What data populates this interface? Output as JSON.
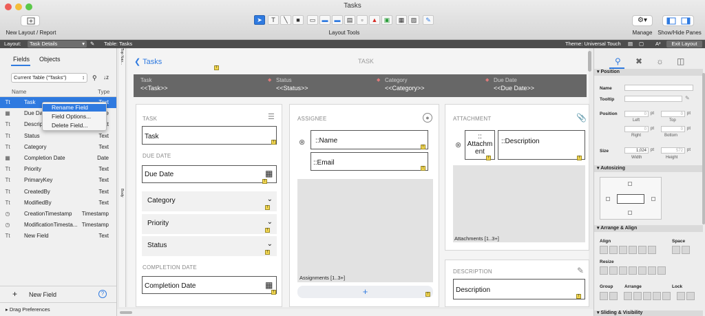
{
  "window": {
    "title": "Tasks"
  },
  "toolbar": {
    "new_layout_label": "New Layout / Report",
    "layout_tools_label": "Layout Tools",
    "manage_label": "Manage",
    "show_hide_label": "Show/Hide Panes",
    "tool_text_glyph": "T"
  },
  "layout_bar": {
    "layout_label": "Layout:",
    "layout_value": "Task Details",
    "table_label": "Table: Tasks",
    "theme_label": "Theme: Universal Touch",
    "exit_label": "Exit Layout",
    "aa_glyph": "A²"
  },
  "left_pane": {
    "tabs": [
      "Fields",
      "Objects"
    ],
    "table_select": "Current Table (\"Tasks\")",
    "sort_glyph": "↓z",
    "col_name": "Name",
    "col_type": "Type",
    "fields": [
      {
        "icon": "Tt",
        "name": "Task",
        "type": "Text",
        "selected": true
      },
      {
        "icon": "▦",
        "name": "Due Date",
        "type": "Date"
      },
      {
        "icon": "Tt",
        "name": "Description",
        "type": "Text"
      },
      {
        "icon": "Tt",
        "name": "Status",
        "type": "Text"
      },
      {
        "icon": "Tt",
        "name": "Category",
        "type": "Text"
      },
      {
        "icon": "▦",
        "name": "Completion Date",
        "type": "Date"
      },
      {
        "icon": "Tt",
        "name": "Priority",
        "type": "Text"
      },
      {
        "icon": "Tt",
        "name": "PrimaryKey",
        "type": "Text"
      },
      {
        "icon": "Tt",
        "name": "CreatedBy",
        "type": "Text"
      },
      {
        "icon": "Tt",
        "name": "ModifiedBy",
        "type": "Text"
      },
      {
        "icon": "◷",
        "name": "CreationTimestamp",
        "type": "Timestamp"
      },
      {
        "icon": "◷",
        "name": "ModificationTimesta...",
        "type": "Timestamp"
      },
      {
        "icon": "Tt",
        "name": "New Field",
        "type": "Text"
      }
    ],
    "new_field_label": "New Field",
    "help_glyph": "?",
    "drag_prefs_label": "Drag Preferences"
  },
  "context_menu": {
    "items": [
      "Rename Field",
      "Field Options...",
      "Delete Field..."
    ]
  },
  "canvas": {
    "top_nav_label": "Top Nav...",
    "body_label": "Body",
    "back_label": "Tasks",
    "header_title": "TASK",
    "header_columns": [
      {
        "label": "Task",
        "field": "<<Task>>"
      },
      {
        "label": "Status",
        "field": "<<Status>>"
      },
      {
        "label": "Category",
        "field": "<<Category>>"
      },
      {
        "label": "Due Date",
        "field": "<<Due Date>>"
      }
    ],
    "task_section": "TASK",
    "task_field": "Task",
    "due_section": "DUE DATE",
    "due_field": "Due Date",
    "dropdowns": [
      "Category",
      "Priority",
      "Status"
    ],
    "completion_section": "COMPLETION DATE",
    "completion_field": "Completion Date",
    "assignee_section": "ASSIGNEE",
    "name_field": "::Name",
    "email_field": "::Email",
    "assignments_label": "Assignments [1..3+]",
    "add_glyph": "+",
    "attachment_section": "ATTACHMENT",
    "attachment_field_line1": "::",
    "attachment_field_line2": "Attachm",
    "attachment_field_line3": "ent",
    "attach_desc_field": "::Description",
    "attachments_label": "Attachments [1..3+]",
    "description_section": "DESCRIPTION",
    "description_field": "Description",
    "badge_glyph": "T"
  },
  "right_pane": {
    "position_header": "Position",
    "name_label": "Name",
    "tooltip_label": "Tooltip",
    "position_label": "Position",
    "left_value": "0",
    "top_value": "0",
    "right_value": "0",
    "bottom_value": "0",
    "unit": "pt",
    "left_label": "Left",
    "top_label": "Top",
    "right_label": "Right",
    "bottom_label": "Bottom",
    "size_label": "Size",
    "width_value": "1,024",
    "height_value": "572",
    "width_label": "Width",
    "height_label": "Height",
    "autosizing_header": "Autosizing",
    "arrange_header": "Arrange & Align",
    "align_label": "Align",
    "space_label": "Space",
    "resize_label": "Resize",
    "group_label": "Group",
    "arrange_label": "Arrange",
    "lock_label": "Lock",
    "sliding_header": "Sliding & Visibility"
  }
}
